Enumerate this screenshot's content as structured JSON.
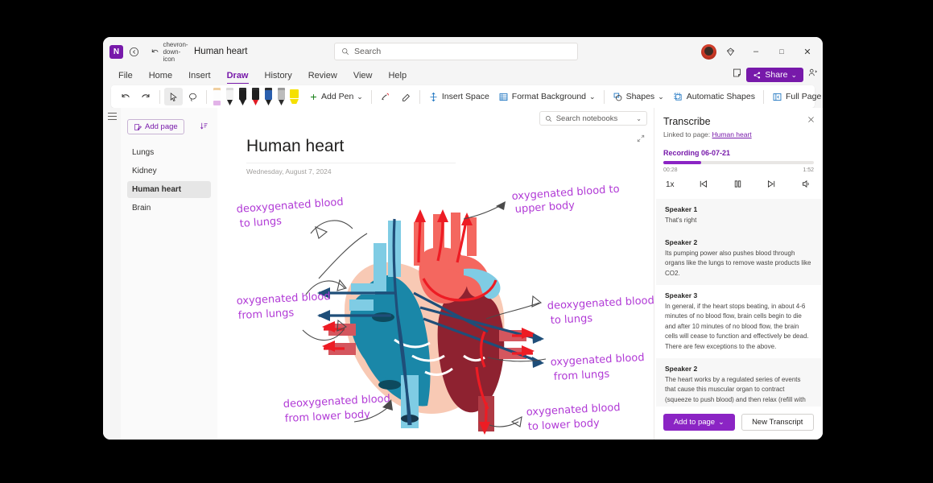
{
  "titlebar": {
    "app_logo": "N",
    "back_icon": "back-icon",
    "undo_icon": "undo-icon",
    "dropdown_icon": "chevron-down-icon",
    "document_title": "Human heart",
    "search_placeholder": "Search",
    "search_icon": "search-icon",
    "diamond_icon": "diamond-icon",
    "minimize": "–",
    "maximize": "□",
    "close": "✕",
    "note_icon": "sticky-note-icon",
    "share_label": "Share",
    "share_icon": "share-icon",
    "share_caret": "⌄",
    "people_icon": "people-icon"
  },
  "ribbon_tabs": [
    {
      "label": "File",
      "active": false
    },
    {
      "label": "Home",
      "active": false
    },
    {
      "label": "Insert",
      "active": false
    },
    {
      "label": "Draw",
      "active": true
    },
    {
      "label": "History",
      "active": false
    },
    {
      "label": "Review",
      "active": false
    },
    {
      "label": "View",
      "active": false
    },
    {
      "label": "Help",
      "active": false
    }
  ],
  "toolbar": {
    "undo": "undo-icon",
    "redo": "redo-icon",
    "select_tool": "lasso-select-icon",
    "lasso_tool": "lasso-icon",
    "pens": [
      {
        "name": "pen-highlighter-pink",
        "cap": "#f0cfa0",
        "body": "#ffffff",
        "nib": "#e2b3e8"
      },
      {
        "name": "pen-white",
        "cap": "#d8d8d8",
        "body": "#f2f2f2",
        "nib": "#2b2b2b"
      },
      {
        "name": "pen-black",
        "cap": "#2b2b2b",
        "body": "#1f1f1f",
        "nib": "#1f1f1f"
      },
      {
        "name": "pen-red",
        "cap": "#2b2b2b",
        "body": "#1f1f1f",
        "nib": "#e01b24"
      },
      {
        "name": "pen-blue",
        "cap": "#2b2b2b",
        "body": "#1f4f9c",
        "nib": "#1f1f1f"
      },
      {
        "name": "pen-gray",
        "cap": "#9a9a9a",
        "body": "#b8b8b8",
        "nib": "#2b2b2b"
      },
      {
        "name": "highlighter-yellow",
        "cap": "#f5e000",
        "body": "#f5e000",
        "nib": "#f5e000"
      }
    ],
    "add_pen_label": "Add Pen",
    "add_pen_icon": "plus-icon",
    "add_pen_caret": "⌄",
    "ink_to_shape_icon": "ink-to-shape-icon",
    "eraser_icon": "eraser-icon",
    "insert_space_label": "Insert Space",
    "insert_space_icon": "insert-space-icon",
    "format_background_label": "Format Background",
    "format_background_icon": "format-background-icon",
    "format_background_caret": "⌄",
    "shapes_label": "Shapes",
    "shapes_icon": "shapes-icon",
    "shapes_caret": "⌄",
    "automatic_shapes_label": "Automatic Shapes",
    "automatic_shapes_icon": "automatic-shapes-icon",
    "full_page_view_label": "Full Page View",
    "full_page_view_icon": "full-page-view-icon",
    "help_icon": "help-circle-icon",
    "more_label": "•••",
    "more_caret": "⌄"
  },
  "sidebar": {
    "hamburger_icon": "hamburger-icon",
    "add_page_label": "Add page",
    "add_page_icon": "edit-page-icon",
    "sort_icon": "sort-icon",
    "pages": [
      {
        "label": "Lungs",
        "active": false
      },
      {
        "label": "Kidney",
        "active": false
      },
      {
        "label": "Human heart",
        "active": true
      },
      {
        "label": "Brain",
        "active": false
      }
    ]
  },
  "canvas": {
    "search_notebooks_placeholder": "Search notebooks",
    "search_notebooks_icon": "search-icon",
    "search_notebooks_caret": "⌄",
    "expand_icon": "expand-icon",
    "page_title": "Human heart",
    "page_date": "Wednesday, August 7, 2024",
    "annotations": [
      {
        "name": "annotation-oxygenated-upper-body",
        "line1": "oxygenated blood to",
        "line2": "upper body"
      },
      {
        "name": "annotation-deoxygenated-to-lungs-left",
        "line1": "deoxygenated blood",
        "line2": "to lungs"
      },
      {
        "name": "annotation-deoxygenated-to-lungs-right",
        "line1": "deoxygenated blood",
        "line2": "to lungs"
      },
      {
        "name": "annotation-oxygenated-from-lungs-left",
        "line1": "oxygenated blood",
        "line2": "from lungs"
      },
      {
        "name": "annotation-oxygenated-from-lungs-right",
        "line1": "oxygenated blood",
        "line2": "from lungs"
      },
      {
        "name": "annotation-deoxygenated-lower-body",
        "line1": "deoxygenated blood",
        "line2": "from lower body"
      },
      {
        "name": "annotation-oxygenated-lower-body",
        "line1": "oxygenated blood",
        "line2": "to lower body"
      }
    ],
    "ink_color": "#b13ad6"
  },
  "transcribe": {
    "title": "Transcribe",
    "close_icon": "close-icon",
    "linked_prefix": "Linked to page:",
    "linked_page": "Human heart",
    "recording_name": "Recording 06-07-21",
    "progress_percent": 25,
    "time_current": "00:28",
    "time_total": "1:52",
    "controls": {
      "speed": "1x",
      "prev_icon": "skip-back-icon",
      "pause_icon": "pause-icon",
      "next_icon": "skip-forward-icon",
      "volume_icon": "volume-icon"
    },
    "entries": [
      {
        "speaker": "Speaker 1",
        "text": "That's right",
        "highlight": false
      },
      {
        "speaker": "Speaker 2",
        "text": "Its pumping power also pushes blood through organs like the lungs to remove waste products like CO2.",
        "highlight": false
      },
      {
        "speaker": "Speaker 3",
        "text": "In general, if the heart stops beating, in about 4-6 minutes of no blood flow, brain cells begin to die and after 10 minutes of no blood flow, the brain cells will cease to function and effectively be dead. There are few exceptions to the above.",
        "highlight": true
      },
      {
        "speaker": "Speaker 2",
        "text": "The heart works by a regulated series of events that cause this muscular organ to contract (squeeze to push blood) and then relax (refill with blood). The normal heart has 4 chambers that undergo the squeeze and relax cycle at specific time intervals",
        "highlight": false
      }
    ],
    "add_to_page_label": "Add to page",
    "add_to_page_caret": "⌄",
    "new_transcript_label": "New Transcript",
    "accent_color": "#8b24c4"
  }
}
